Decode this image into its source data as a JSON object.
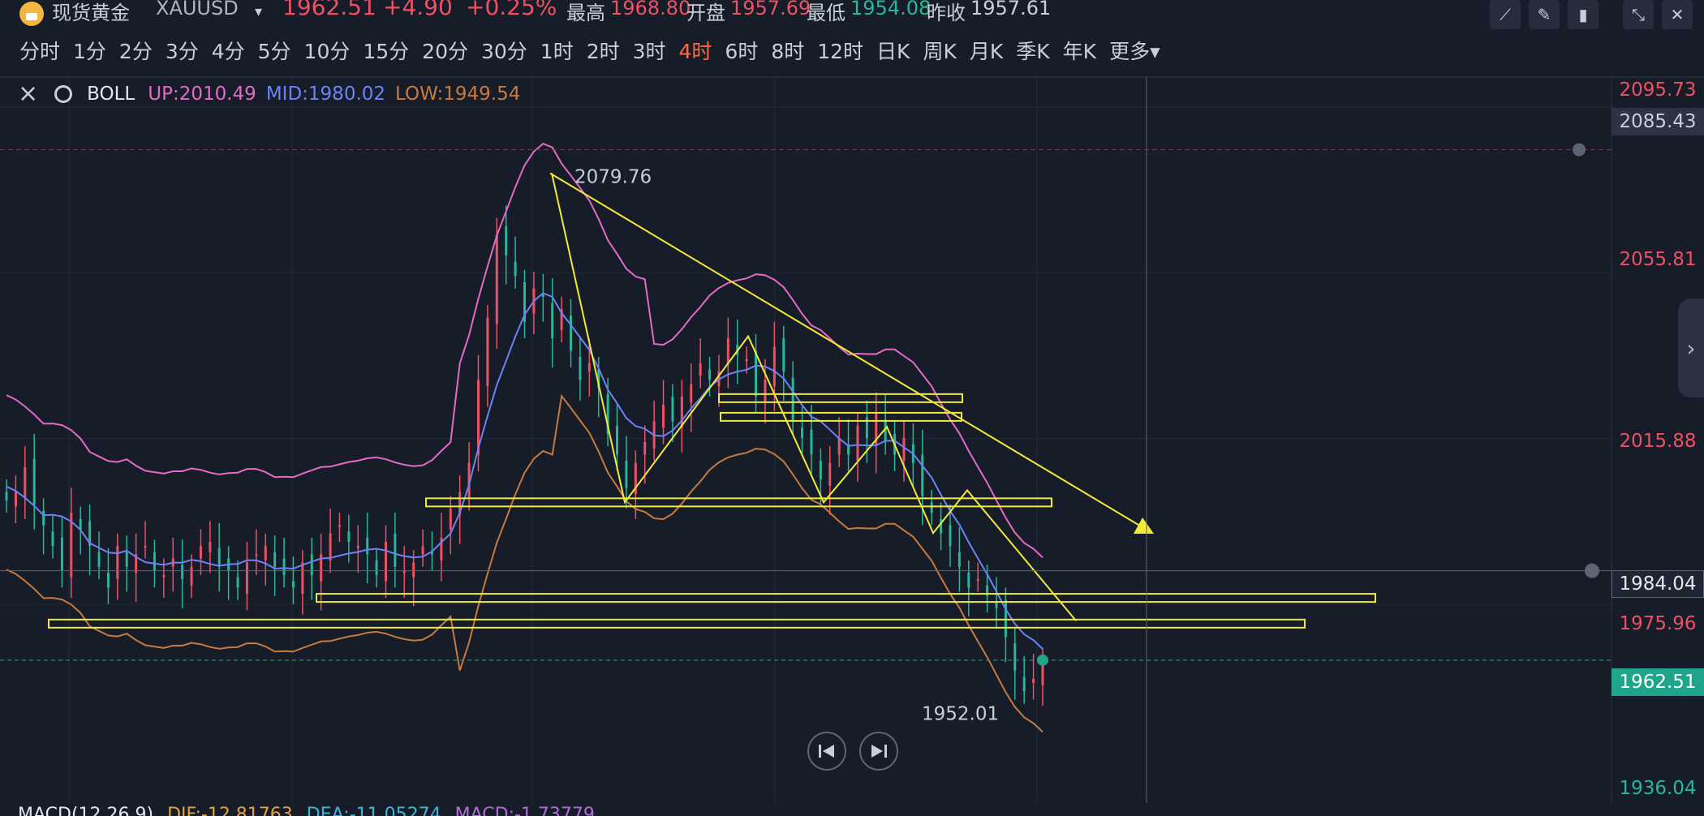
{
  "header": {
    "symbol_name": "现货黄金",
    "symbol_code": "XAUUSD",
    "price": "1962.51",
    "change": "+4.90",
    "change_pct": "+0.25%",
    "high_label": "最高",
    "high": "1968.80",
    "open_label": "开盘",
    "open": "1957.69",
    "low_label": "最低",
    "low": "1954.08",
    "prev_label": "昨收",
    "prev": "1957.61"
  },
  "periods": [
    "分时",
    "1分",
    "2分",
    "3分",
    "4分",
    "5分",
    "10分",
    "15分",
    "20分",
    "30分",
    "1时",
    "2时",
    "3时",
    "4时",
    "6时",
    "8时",
    "12时",
    "日K",
    "周K",
    "月K",
    "季K",
    "年K",
    "更多"
  ],
  "active_period": "4时",
  "legend": {
    "name": "BOLL",
    "up": "UP:2010.49",
    "mid": "MID:1980.02",
    "low": "LOW:1949.54"
  },
  "price_axis": {
    "ticks": [
      "2095.73",
      "2055.81",
      "2015.88",
      "1975.96",
      "1936.04"
    ],
    "alert_price": "2085.43",
    "crosshair_price": "1984.04",
    "current_price": "1962.51"
  },
  "macd": {
    "name": "MACD(12,26,9)",
    "dif": "DIF:-12.81763",
    "dea": "DEA:-11.05274",
    "macd": "MACD:-1.73779"
  },
  "colors": {
    "background": "#161c28",
    "up": "#ef5164",
    "down": "#27b79a",
    "boll_up": "#e26bc7",
    "boll_mid": "#6c83f4",
    "boll_low": "#c67a3f",
    "drawing": "#f2ea3a",
    "active_period": "#ff6a3d"
  },
  "chart_data": {
    "type": "candlestick",
    "symbol": "XAUUSD",
    "timeframe": "4时",
    "ylim": [
      1932,
      2100
    ],
    "indicator": "BOLL",
    "annotations": [
      {
        "label": "2079.76",
        "kind": "swing-high"
      },
      {
        "label": "1952.01",
        "kind": "swing-low"
      }
    ],
    "current_price": 1962.51,
    "alert_price": 2085.43,
    "crosshair_price": 1984.04,
    "boll": {
      "up": 2010.49,
      "mid": 1980.02,
      "low": 1949.54
    },
    "horizontal_levels": [
      2025.6,
      2021.1,
      2000.5,
      1977.5,
      1971.3
    ],
    "trendline": {
      "from": 2079.76,
      "to": 1994.5
    },
    "zigzag": [
      2079.76,
      2000.5,
      2040.5,
      2000.5,
      2018.7,
      1993.1,
      2003.4,
      1972.0
    ],
    "candles_close": [
      2001,
      2003,
      2009,
      2000,
      1995,
      1990,
      1984,
      1998,
      1994,
      1990,
      1985,
      1980,
      1990,
      1985,
      1988,
      1990,
      1984,
      1983,
      1987,
      1982,
      1985,
      1990,
      1991,
      1985,
      1984,
      1980,
      1986,
      1988,
      1990,
      1985,
      1983,
      1980,
      1986,
      1983,
      1988,
      1993,
      1995,
      1991,
      1990,
      1988,
      1983,
      1991,
      1985,
      1984,
      1986,
      1990,
      1988,
      1992,
      1999,
      2003,
      2010,
      2030,
      2045,
      2065,
      2060,
      2055,
      2044,
      2052,
      2050,
      2040,
      2047,
      2037,
      2030,
      2034,
      2028,
      2017,
      2012,
      2004,
      2010,
      2015,
      2020,
      2024,
      2020,
      2026,
      2029,
      2034,
      2030,
      2032,
      2040,
      2036,
      2035,
      2026,
      2030,
      2038,
      2032,
      2020,
      2016,
      2012,
      2006,
      2010,
      2016,
      2012,
      2019,
      2016,
      2022,
      2015,
      2012,
      2016,
      2010,
      2002,
      1998,
      1993,
      1990,
      1985,
      1980,
      1982,
      1978,
      1975,
      1968,
      1960,
      1955,
      1958,
      1962.51
    ]
  }
}
